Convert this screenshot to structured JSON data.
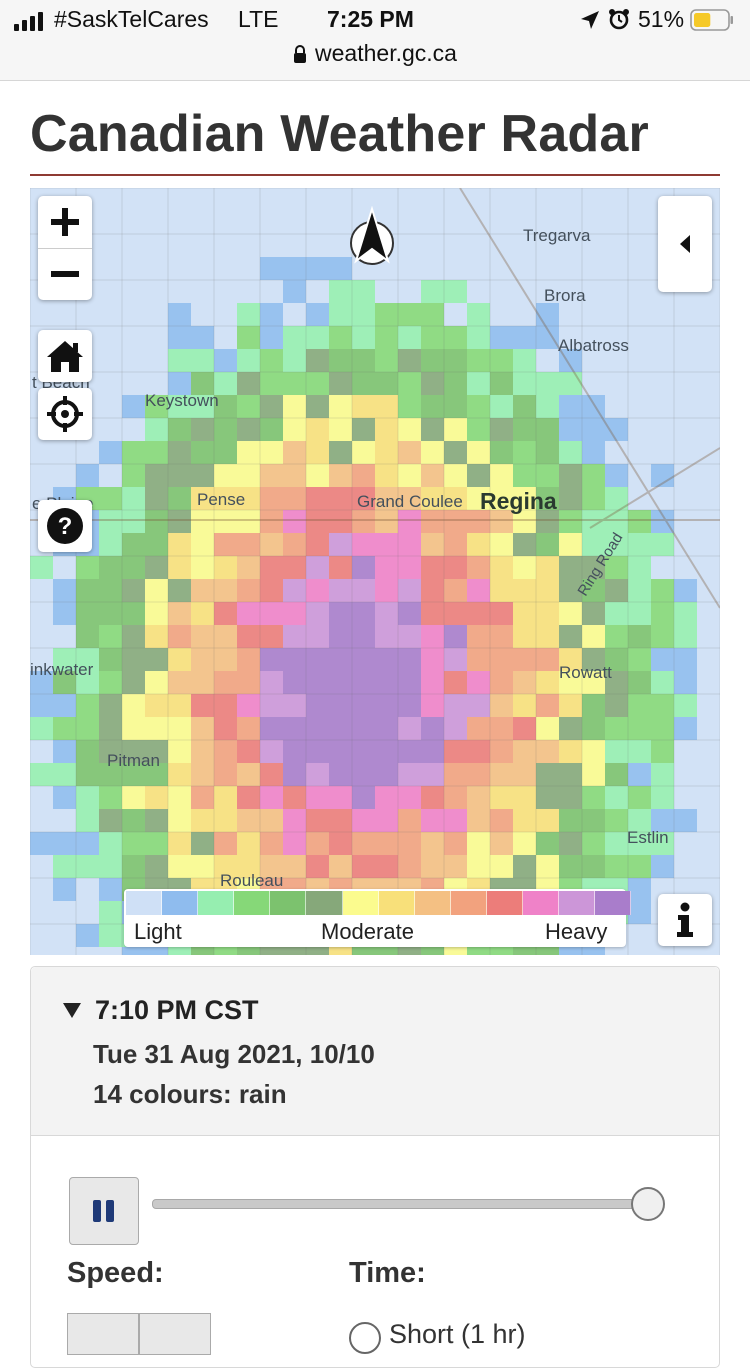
{
  "status_bar": {
    "carrier": "#SaskTelCares",
    "network": "LTE",
    "time": "7:25 PM",
    "battery": "51%",
    "url": "weather.gc.ca",
    "battery_level": 0.51,
    "icons": [
      "signal-icon",
      "location-arrow-icon",
      "alarm-icon",
      "battery-icon",
      "lock-icon"
    ]
  },
  "page": {
    "title": "Canadian Weather Radar",
    "rule_color": "#8e3a33"
  },
  "map": {
    "labels": {
      "tregarva": "Tregarva",
      "brora": "Brora",
      "albatross": "Albatross",
      "keystown": "Keystown",
      "beach": "t Beach",
      "pense": "Pense",
      "grand_coulee": "Grand Coulee",
      "regina": "Regina",
      "ring_road": "Ring Road",
      "plaine": "e Plaine",
      "drinkwater": "inkwater",
      "rowatt": "Rowatt",
      "pitman": "Pitman",
      "estlin": "Estlin",
      "rouleau": "Rouleau"
    },
    "controls": {
      "zoom_in": "+",
      "zoom_out": "−",
      "home": "home-icon",
      "locate": "locate-icon",
      "help": "help-icon",
      "north": "north-arrow-icon",
      "collapse": "collapse-panel-icon",
      "info": "info-icon"
    },
    "legend": {
      "low_label": "Light",
      "mid_label": "Moderate",
      "high_label": "Heavy",
      "colors": [
        "#cfe0f6",
        "#8fbcee",
        "#96eeb0",
        "#86d878",
        "#7cc26e",
        "#86a87a",
        "#fbfb8e",
        "#f8e07a",
        "#f4c083",
        "#f2a27e",
        "#ec7d7a",
        "#ef82c8",
        "#cc96d8",
        "#a97dcb"
      ]
    }
  },
  "panel": {
    "time": "7:10 PM CST",
    "date": "Tue 31 Aug 2021, 10/10",
    "colours": "14 colours: rain",
    "speed_label": "Speed:",
    "time_label": "Time:",
    "radio_option": "Short (1 hr)",
    "progress": 1.0
  }
}
